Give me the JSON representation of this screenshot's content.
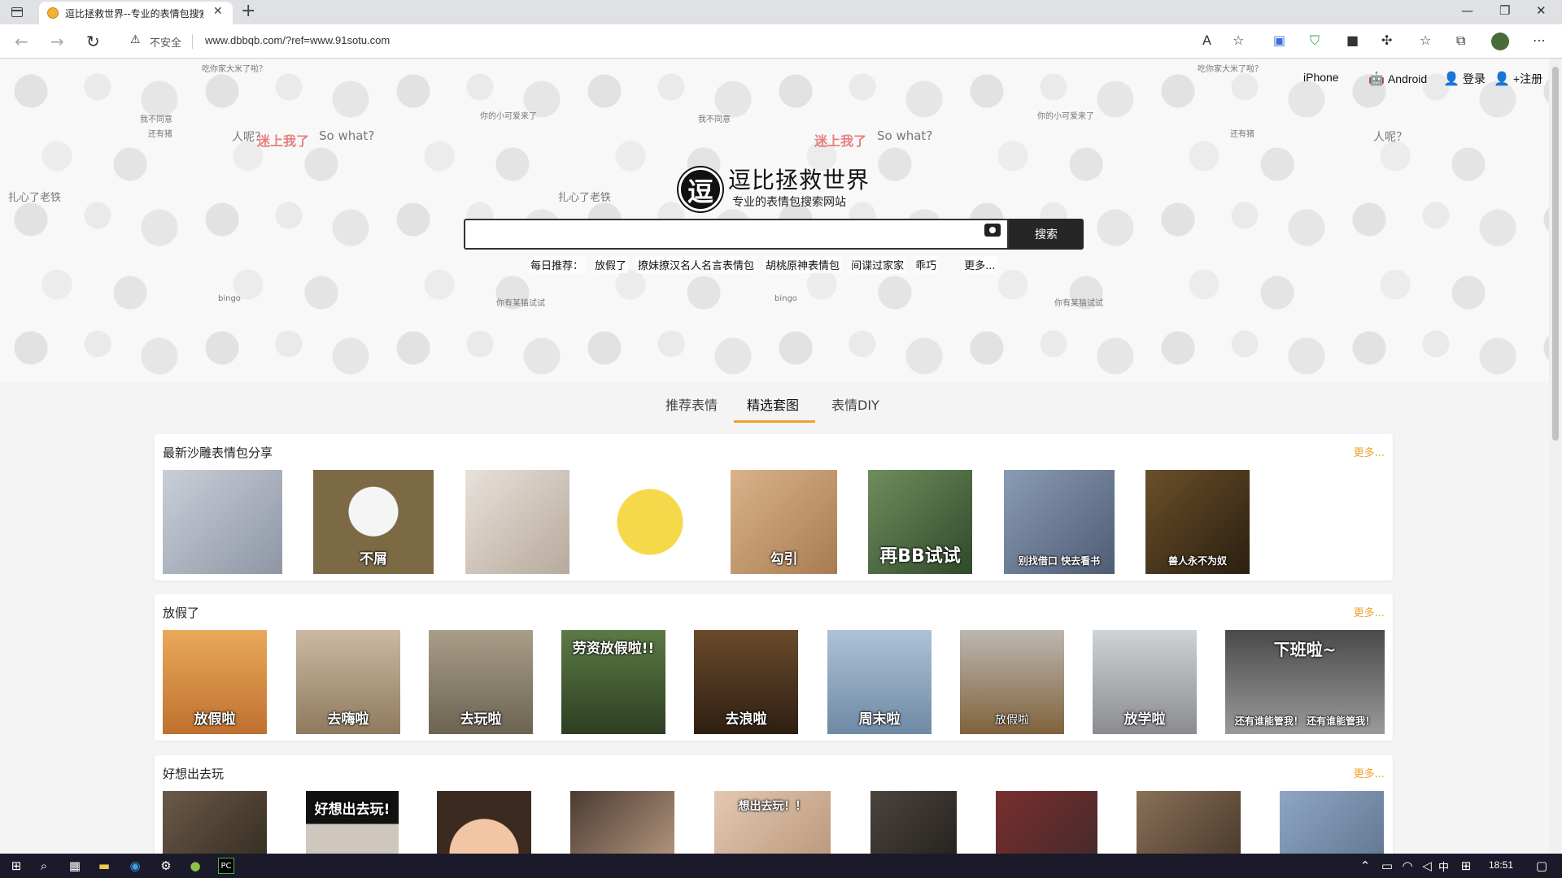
{
  "browser": {
    "tab_title": "逗比拯救世界--专业的表情包搜索",
    "tab_close": "✕",
    "new_tab": "+",
    "security_label": "不安全",
    "url": "www.dbbqb.com/?ref=www.91sotu.com",
    "window_controls": [
      "—",
      "❐",
      "✕"
    ],
    "accent": "#f0a030"
  },
  "header": {
    "links": [
      {
        "icon": "apple-icon",
        "glyph": "",
        "label": "iPhone"
      },
      {
        "icon": "android-icon",
        "glyph": "🤖",
        "label": "Android"
      },
      {
        "icon": "user-icon",
        "glyph": "👤",
        "label": "登录"
      },
      {
        "icon": "user-add-icon",
        "glyph": "👤",
        "label": "+注册"
      }
    ],
    "logo_glyph": "逗",
    "site_title": "逗比拯救世界",
    "site_subtitle": "专业的表情包搜索网站",
    "search_button": "搜索",
    "daily_label": "每日推荐：",
    "daily_items": [
      "放假了",
      "撩妹撩汉名人名言表情包",
      "胡桃原神表情包",
      "间谍过家家",
      "乖巧"
    ],
    "daily_more": "更多..."
  },
  "banner_texts": [
    "迷上我了",
    "迷上我了",
    "So what?",
    "So what?",
    "扎心了老铁",
    "扎心了老铁",
    "我不同意",
    "我不同意",
    "你的小可爱来了",
    "你的小可爱来了",
    "吃你家大米了啦？",
    "吃你家大米了啦？",
    "人呢？",
    "人呢？",
    "还有猪",
    "还有猪",
    "bingo",
    "bingo",
    "你有某猫试试",
    "你有某猫试试"
  ],
  "nav_tabs": [
    "推荐表情",
    "精选套图",
    "表情DIY"
  ],
  "sections": [
    {
      "title": "最新沙雕表情包分享",
      "more": "更多...",
      "captions": [
        "",
        "不屑",
        "",
        "",
        "勾引",
        "再BB试试",
        "别找借口 快去看书",
        "兽人永不为奴",
        ""
      ]
    },
    {
      "title": "放假了",
      "more": "更多...",
      "captions": [
        "放假啦",
        "去嗨啦",
        "去玩啦",
        "劳资放假啦!!",
        "去浪啦",
        "周末啦",
        "放假啦",
        "放学啦",
        "下班啦~",
        "还有谁能管我！ 还有谁能管我！"
      ]
    },
    {
      "title": "好想出去玩",
      "more": "更多...",
      "captions": [
        "",
        "好想出去玩!",
        "",
        "",
        "想出去玩！！",
        "",
        "",
        "",
        ""
      ]
    }
  ],
  "taskbar": {
    "time": "18:51",
    "ime": "中"
  }
}
